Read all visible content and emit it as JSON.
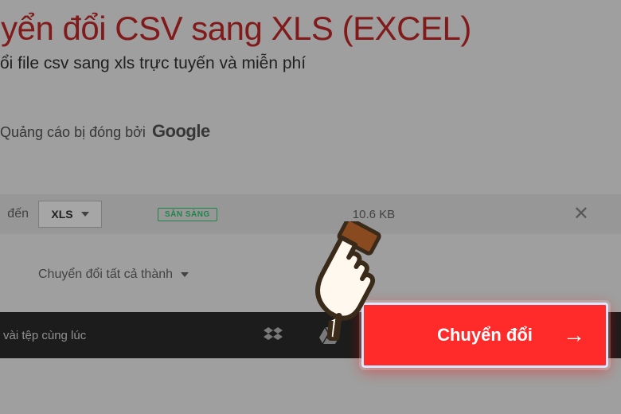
{
  "header": {
    "title": "ıyển đổi CSV sang XLS (EXCEL)",
    "subtitle": "ổi file csv sang xls trực tuyến và miễn phí"
  },
  "ad": {
    "closed_text": "Quảng cáo bị đóng bởi",
    "brand": "Google"
  },
  "file_row": {
    "to_label": "đến",
    "format": "XLS",
    "status_badge": "SẴN SÀNG",
    "size": "10.6 KB"
  },
  "convert_all": {
    "label": "Chuyển đổi tất cả thành"
  },
  "bottombar": {
    "hint": "vài tệp cùng lúc"
  },
  "cta": {
    "label": "Chuyển đổi"
  }
}
